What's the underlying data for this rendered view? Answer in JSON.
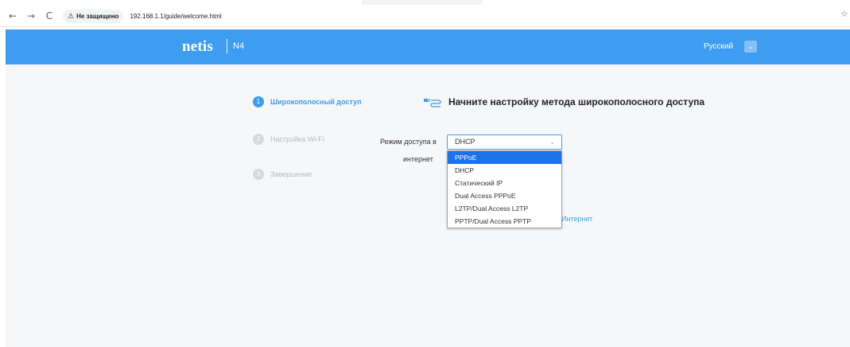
{
  "browser": {
    "back_icon": "←",
    "forward_icon": "→",
    "reload_icon": "C",
    "warning_icon": "⚠",
    "security_label": "Не защищено",
    "url": "192.168.1.1/guide/welcome.html",
    "star_icon": "☆"
  },
  "header": {
    "logo": "netis",
    "model": "N4",
    "language": "Русский",
    "language_chevron": "⌄"
  },
  "steps": [
    {
      "number": "1",
      "label": "Широкополосный доступ",
      "active": true
    },
    {
      "number": "2",
      "label": "Настройка Wi-Fi",
      "active": false
    },
    {
      "number": "3",
      "label": "Завершение",
      "active": false
    }
  ],
  "section": {
    "title": "Начните настройку метода широкополосного доступа",
    "icon": "plug-icon"
  },
  "form": {
    "label_line1": "Режим доступа в",
    "label_line2": "интернет",
    "selected_value": "DHCP",
    "chevron": "⌄",
    "options": [
      "PPPoE",
      "DHCP",
      "Статический IP",
      "Dual Access PPPoE",
      "L2TP/Dual Access L2TP",
      "PPTP/Dual Access PPTP"
    ],
    "highlighted_option": "PPPoE"
  },
  "partial_link": "Интернет",
  "colors": {
    "accent": "#3e9df0",
    "dropdown_highlight": "#1a73e8"
  }
}
